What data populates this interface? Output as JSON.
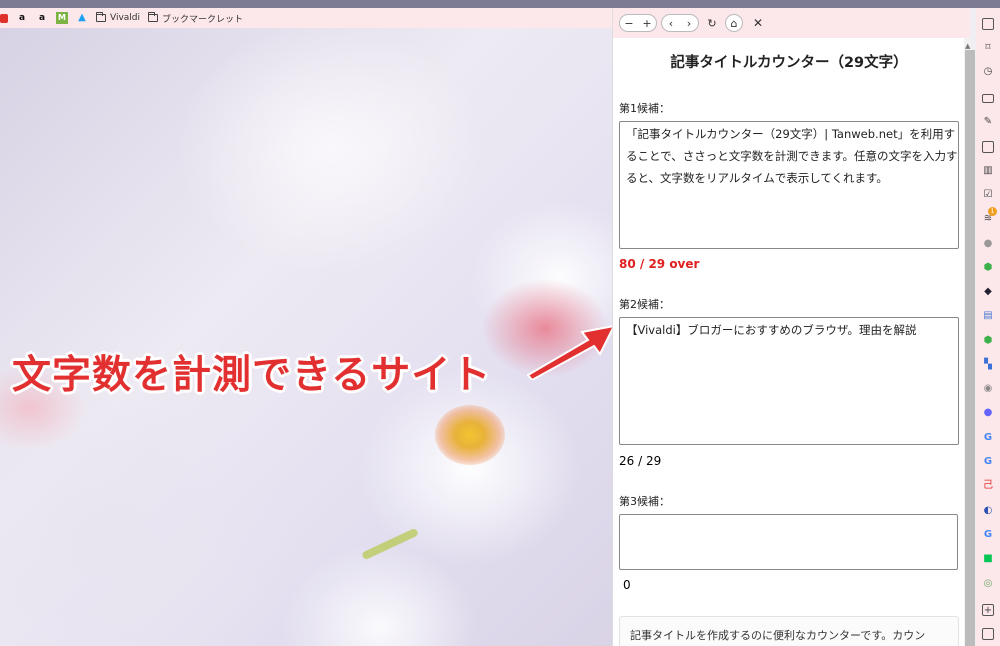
{
  "bookmarks_bar": {
    "items": [
      {
        "icon": "youtube-icon",
        "label": ""
      },
      {
        "icon": "amazon-icon",
        "label": "a"
      },
      {
        "icon": "amazon-icon",
        "label": "a"
      },
      {
        "icon": "m-app-icon",
        "label": "M"
      },
      {
        "icon": "twitter-icon",
        "label": "🐦"
      },
      {
        "icon": "folder-icon",
        "label": "Vivaldi"
      },
      {
        "icon": "folder-icon",
        "label": "ブックマークレット"
      }
    ]
  },
  "annotation": {
    "text": "文字数を計測できるサイト",
    "color": "#e23030"
  },
  "panel_toolbar": {
    "zoom_out": "−",
    "zoom_in": "+",
    "back": "‹",
    "forward": "›",
    "reload": "↻",
    "home": "⌂",
    "close": "✕"
  },
  "page": {
    "title": "記事タイトルカウンター（29文字）",
    "candidates": [
      {
        "label": "第1候補：",
        "lines": [
          "「記事タイトルカウンター（29文字）| Tanweb.net」を利用す",
          "ることで、ささっと文字数を計測できます。任意の文字を入力す",
          "ると、文字数をリアルタイムで表示してくれます。"
        ],
        "count": "80 / 29 over",
        "over": true
      },
      {
        "label": "第2候補：",
        "lines": [
          "【Vivaldi】ブロガーにおすすめのブラウザ。理由を解説"
        ],
        "count": "26 / 29",
        "over": false
      },
      {
        "label": "第3候補：",
        "lines": [
          ""
        ],
        "count": "0",
        "over": false
      }
    ],
    "description": "記事タイトルを作成するのに便利なカウンターです。カウン"
  },
  "sidebar_icons": [
    "tabs-icon",
    "bookmark-icon",
    "history-icon",
    "mail-icon",
    "notes-icon",
    "calendar-icon",
    "reader-icon",
    "tasks-icon",
    "feed-icon",
    "web-panel-icon",
    "web-panel-icon",
    "web-panel-icon",
    "web-panel-icon",
    "web-panel-icon",
    "translate-icon",
    "web-panel-icon",
    "mastodon-icon",
    "google-icon",
    "google-icon",
    "web-panel-icon",
    "web-panel-icon",
    "google-icon",
    "line-icon",
    "web-panel-icon",
    "add-panel-icon",
    "window-icon"
  ],
  "feed_badge": "1"
}
